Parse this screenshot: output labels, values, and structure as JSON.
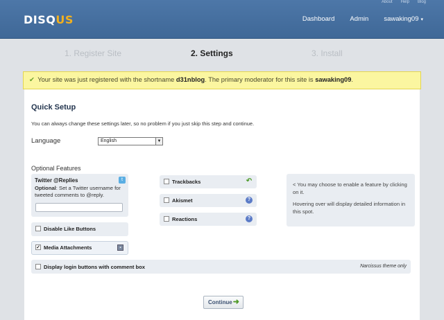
{
  "header": {
    "logo_main": "DISQ",
    "logo_accent": "US",
    "top_links": [
      "About",
      "Help",
      "Blog"
    ],
    "nav": [
      "Dashboard",
      "Admin",
      "sawaking09"
    ],
    "user_caret": "▾"
  },
  "steps": [
    "1. Register Site",
    "2. Settings",
    "3. Install"
  ],
  "alert": {
    "icon": "check-icon",
    "prefix": "Your site was just registered with the shortname",
    "shortname": "d31nblog",
    "middle": ". The primary moderator for this site is",
    "moderator": "sawaking09",
    "suffix": "."
  },
  "quick_setup": {
    "title": "Quick Setup",
    "description": "You can always change these settings later, so no problem if you just skip this step and continue.",
    "language_label": "Language",
    "language_value": "English",
    "optional_label": "Optional Features"
  },
  "features": {
    "twitter_title": "Twitter @Replies",
    "twitter_optional": "Optional",
    "twitter_desc": ": Set a Twitter username for tweeted comments to @reply.",
    "twitter_input_value": "",
    "disable_like": "Disable Like Buttons",
    "media_attachments": "Media Attachments",
    "media_checked": "✓",
    "login_buttons": "Display login buttons with comment box",
    "narcissus_note": "Narcissus theme only",
    "trackbacks": "Trackbacks",
    "akismet": "Akismet",
    "reactions": "Reactions"
  },
  "info": {
    "line1": "< You may choose to enable a feature by clicking on it.",
    "line2": "Hovering over will display detailed information in this spot."
  },
  "continue_label": "Continue"
}
